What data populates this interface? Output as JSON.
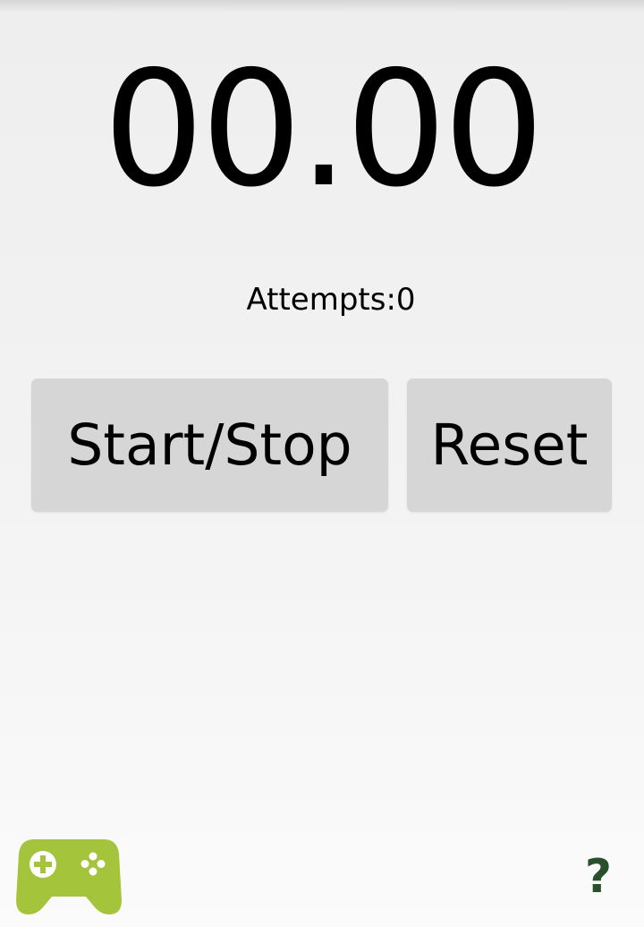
{
  "timer": {
    "display": "00.00"
  },
  "stats": {
    "attempts_label": "Attempts:0"
  },
  "controls": {
    "start_stop_label": "Start/Stop",
    "reset_label": "Reset"
  },
  "footer": {
    "games_icon": "gamepad-icon",
    "games_icon_color": "#a4c43c",
    "help_label": "?",
    "help_color": "#28502a"
  },
  "colors": {
    "button_background": "#d6d6d6",
    "text": "#000000"
  }
}
